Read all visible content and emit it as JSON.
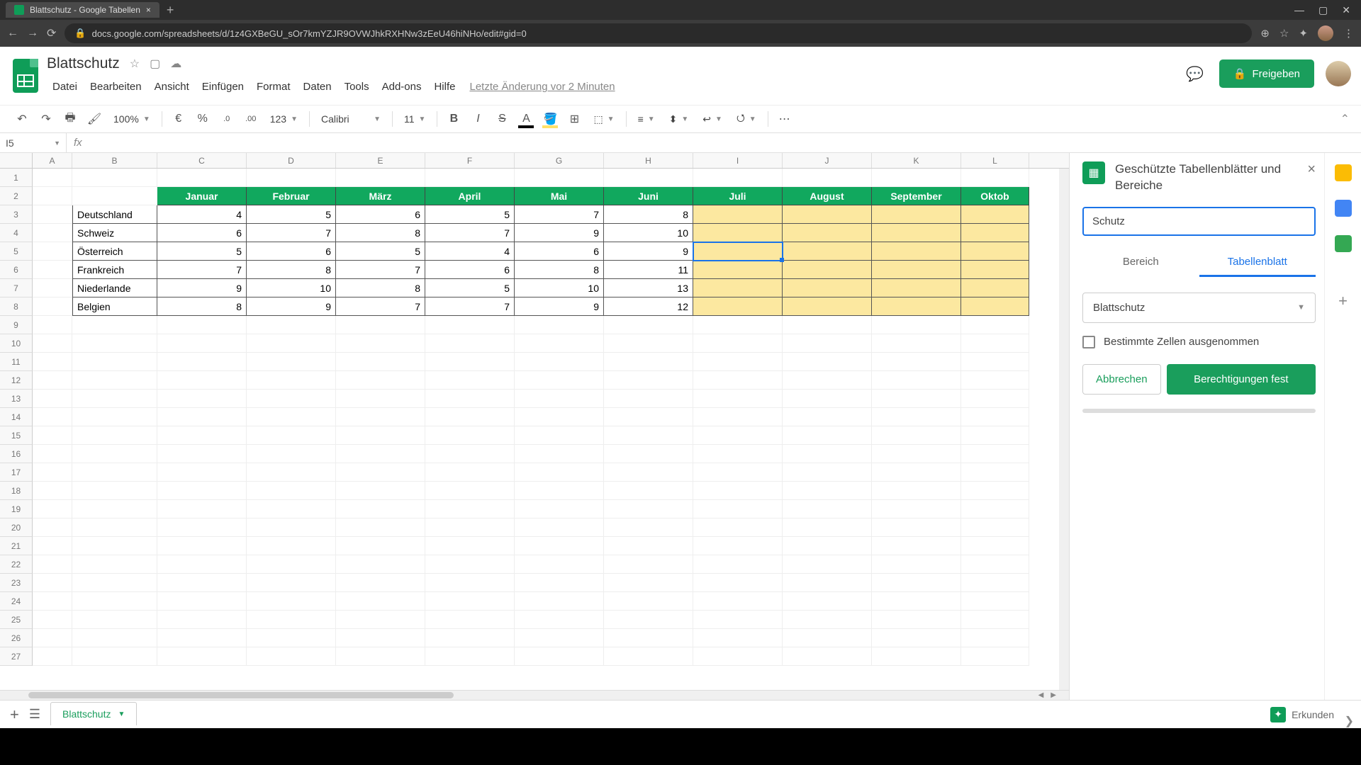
{
  "browser": {
    "tab_title": "Blattschutz - Google Tabellen",
    "url": "docs.google.com/spreadsheets/d/1z4GXBeGU_sOr7kmYZJR9OVWJhkRXHNw3zEeU46hiNHo/edit#gid=0"
  },
  "doc": {
    "title": "Blattschutz",
    "last_edit": "Letzte Änderung vor 2 Minuten"
  },
  "menu": [
    "Datei",
    "Bearbeiten",
    "Ansicht",
    "Einfügen",
    "Format",
    "Daten",
    "Tools",
    "Add-ons",
    "Hilfe"
  ],
  "share_label": "Freigeben",
  "toolbar": {
    "zoom": "100%",
    "currency": "€",
    "percent": "%",
    "dec_minus": ".0",
    "dec_plus": ".00",
    "num_format": "123",
    "font": "Calibri",
    "size": "11"
  },
  "name_box": "I5",
  "columns": [
    "A",
    "B",
    "C",
    "D",
    "E",
    "F",
    "G",
    "H",
    "I",
    "J",
    "K",
    "L"
  ],
  "col_widths": [
    "cwA",
    "cwB",
    "cwC",
    "cwD",
    "cwE",
    "cwF",
    "cwG",
    "cwH",
    "cwI",
    "cwJ",
    "cwK",
    "cwL"
  ],
  "data": {
    "months": [
      "Januar",
      "Februar",
      "März",
      "April",
      "Mai",
      "Juni",
      "Juli",
      "August",
      "September",
      "Oktob"
    ],
    "rows": [
      {
        "label": "Deutschland",
        "vals": [
          4,
          5,
          6,
          5,
          7,
          8
        ]
      },
      {
        "label": "Schweiz",
        "vals": [
          6,
          7,
          8,
          7,
          9,
          10
        ]
      },
      {
        "label": "Österreich",
        "vals": [
          5,
          6,
          5,
          4,
          6,
          9
        ]
      },
      {
        "label": "Frankreich",
        "vals": [
          7,
          8,
          7,
          6,
          8,
          11
        ]
      },
      {
        "label": "Niederlande",
        "vals": [
          9,
          10,
          8,
          5,
          10,
          13
        ]
      },
      {
        "label": "Belgien",
        "vals": [
          8,
          9,
          7,
          7,
          9,
          12
        ]
      }
    ]
  },
  "panel": {
    "title": "Geschützte Tabellenblätter und Bereiche",
    "input_value": "Schutz",
    "tab_range": "Bereich",
    "tab_sheet": "Tabellenblatt",
    "select_value": "Blattschutz",
    "checkbox_label": "Bestimmte Zellen ausgenommen",
    "cancel": "Abbrechen",
    "confirm": "Berechtigungen fest"
  },
  "sheet_tab": "Blattschutz",
  "explore": "Erkunden"
}
